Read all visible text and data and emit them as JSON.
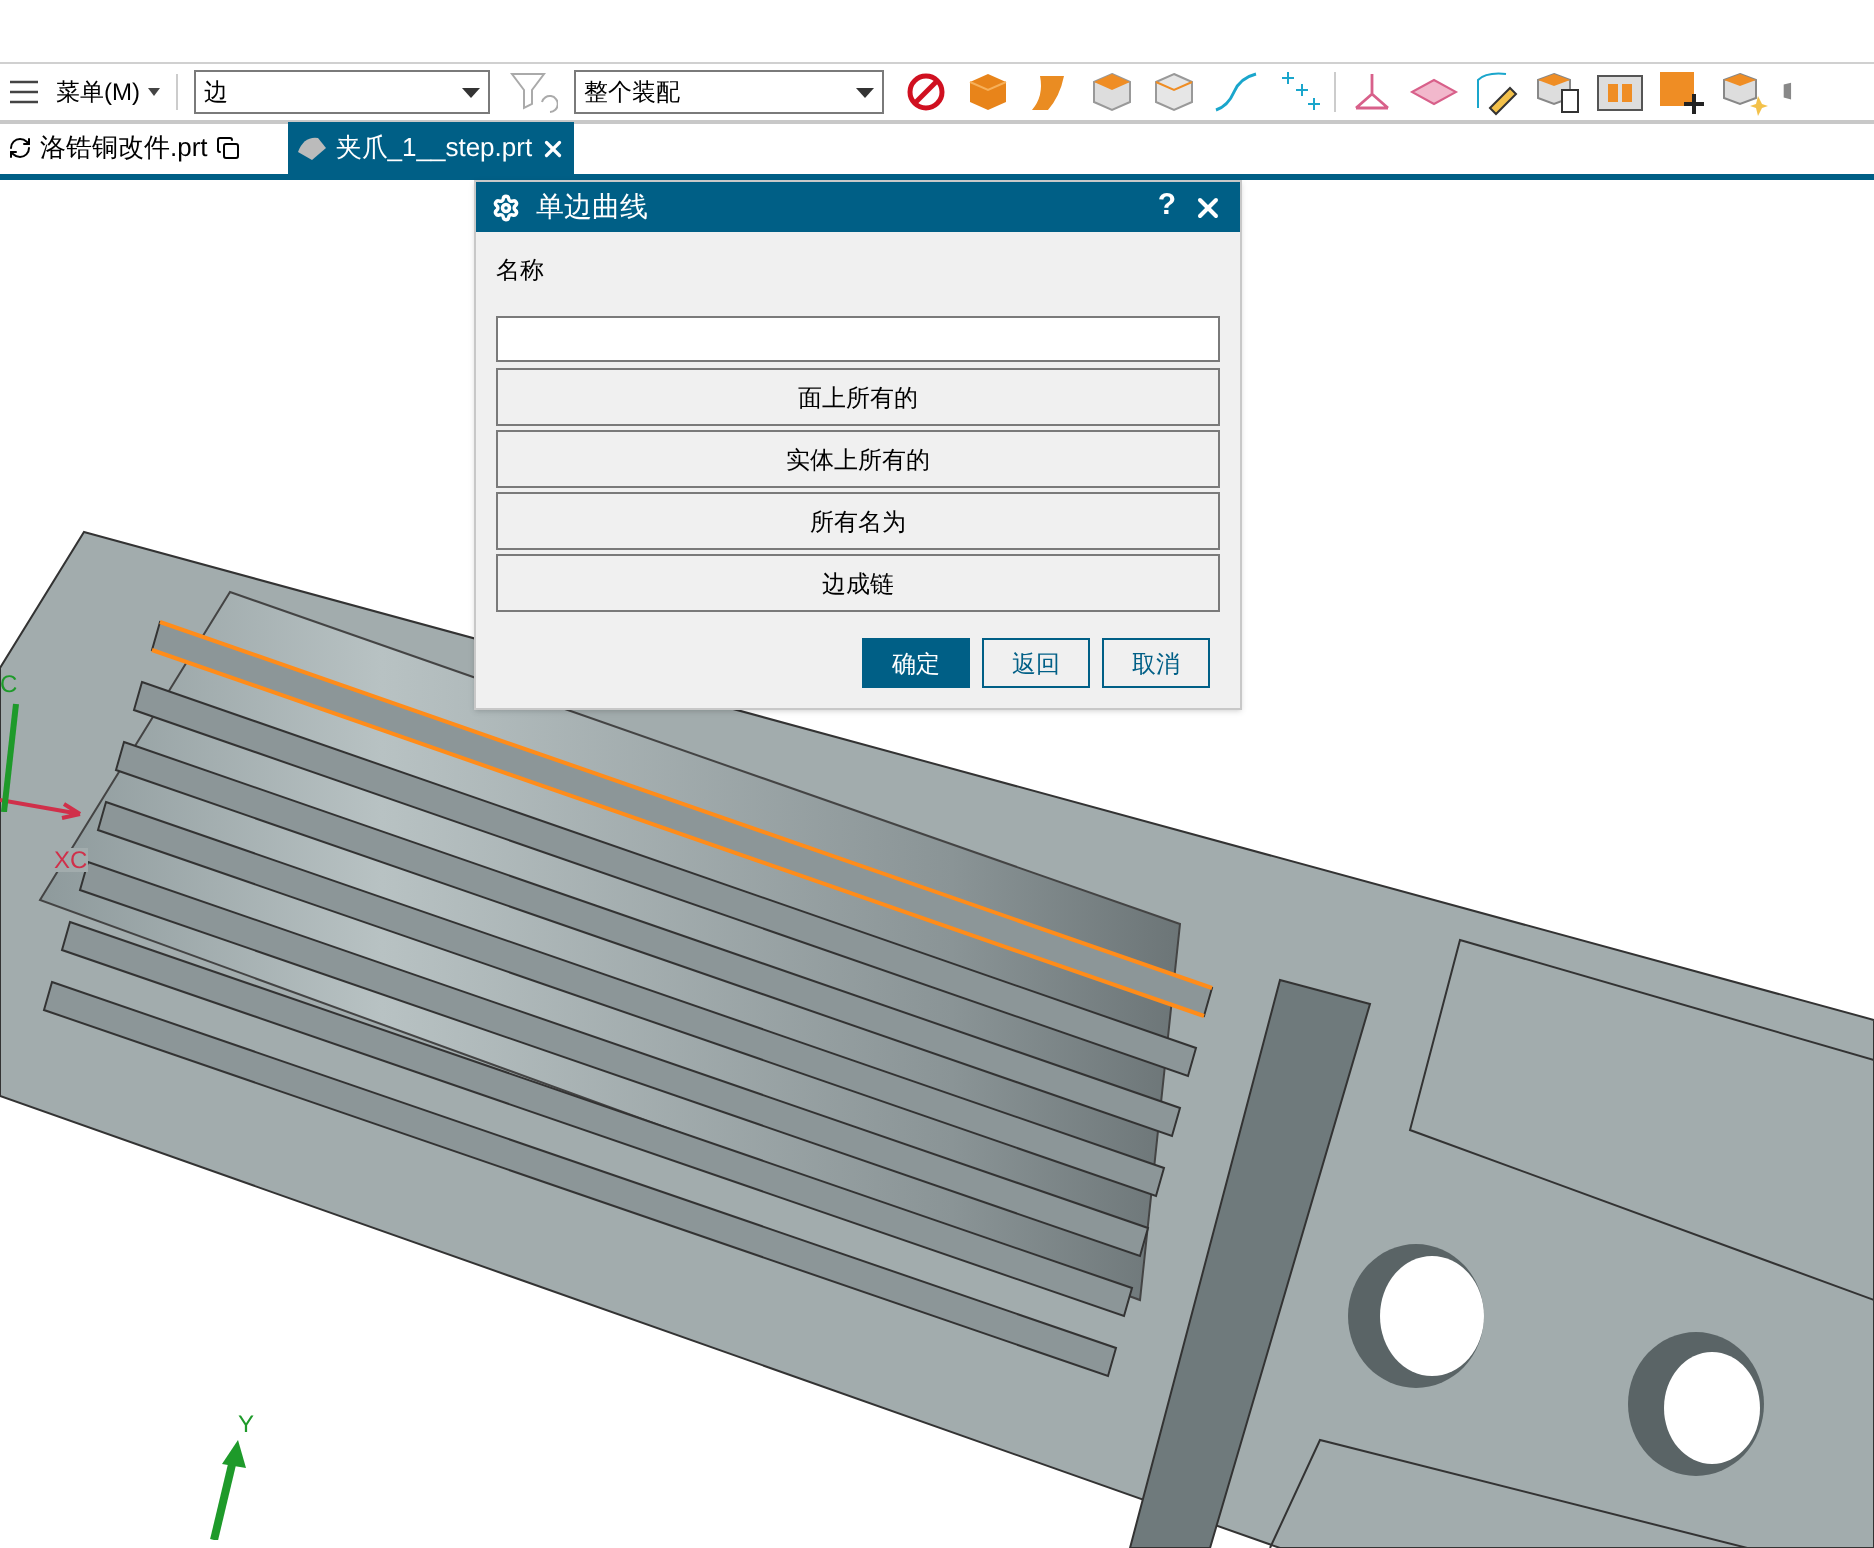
{
  "toolbar": {
    "menu_label": "菜单(M)",
    "type_filter": {
      "value": "边"
    },
    "scope_filter": {
      "value": "整个装配"
    }
  },
  "tabs": [
    {
      "label": "洛锆铜改件.prt",
      "selected": false
    },
    {
      "label": "夹爪_1__step.prt",
      "selected": true
    }
  ],
  "dialog": {
    "title": "单边曲线",
    "help": "?",
    "name_label": "名称",
    "options": [
      "面上所有的",
      "实体上所有的",
      "所有名为",
      "边成链"
    ],
    "actions": [
      {
        "label": "确定",
        "kind": "primary"
      },
      {
        "label": "返回",
        "kind": "secondary"
      },
      {
        "label": "取消",
        "kind": "secondary"
      }
    ]
  },
  "axes": [
    {
      "label": "C",
      "kind": "z"
    },
    {
      "label": "XC",
      "kind": "x"
    },
    {
      "label": "Y",
      "kind": "y"
    }
  ]
}
